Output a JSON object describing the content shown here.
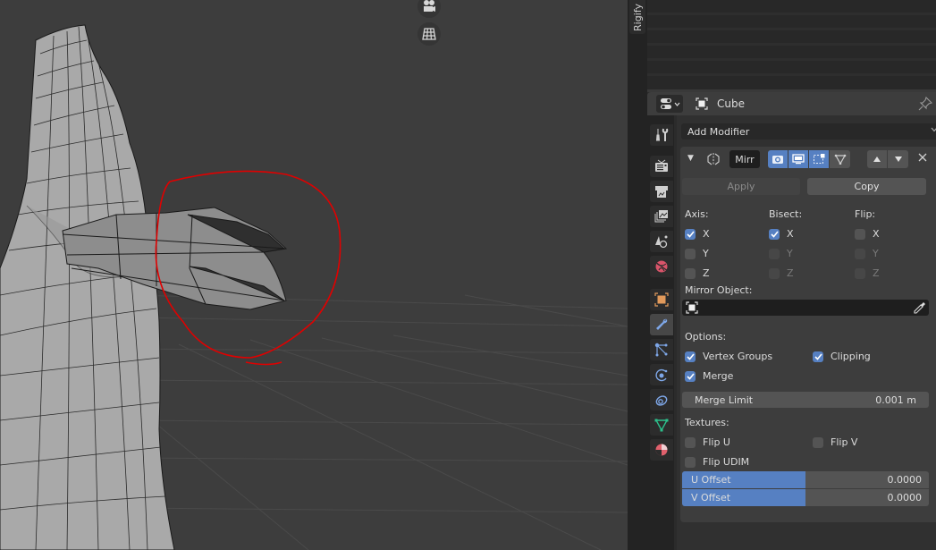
{
  "viewport": {
    "gizmos": [
      {
        "name": "camera-view-icon"
      },
      {
        "name": "perspective-grid-icon"
      }
    ],
    "annotation_color": "#e00000",
    "background": "#3d3d3d"
  },
  "sidebar": {
    "tab_label": "Rigify"
  },
  "properties": {
    "header": {
      "editor_type_icon": "properties-editor-icon",
      "object_icon": "object-icon",
      "object_name": "Cube",
      "pin_icon": "pin-icon"
    },
    "tabs": [
      {
        "name": "tool",
        "icon": "tool-icon",
        "color": "#cfcfcf",
        "active": false
      },
      {
        "name": "render",
        "icon": "render-icon",
        "color": "#cfcfcf",
        "active": false
      },
      {
        "name": "output",
        "icon": "output-icon",
        "color": "#cfcfcf",
        "active": false
      },
      {
        "name": "view-layer",
        "icon": "view-layer-icon",
        "color": "#cfcfcf",
        "active": false
      },
      {
        "name": "scene",
        "icon": "scene-icon",
        "color": "#cfcfcf",
        "active": false
      },
      {
        "name": "world",
        "icon": "world-icon",
        "color": "#d9546a",
        "active": false
      },
      {
        "name": "object",
        "icon": "object-icon",
        "color": "#e29a5b",
        "active": false
      },
      {
        "name": "modifiers",
        "icon": "wrench-icon",
        "color": "#7ea7e8",
        "active": true
      },
      {
        "name": "particles",
        "icon": "particles-icon",
        "color": "#7ea7e8",
        "active": false
      },
      {
        "name": "physics",
        "icon": "physics-icon",
        "color": "#7ea7e8",
        "active": false
      },
      {
        "name": "constraints",
        "icon": "constraints-icon",
        "color": "#7ea7e8",
        "active": false
      },
      {
        "name": "data",
        "icon": "mesh-data-icon",
        "color": "#2cc08c",
        "active": false
      },
      {
        "name": "material",
        "icon": "material-icon",
        "color": "#e0606c",
        "active": false
      }
    ],
    "add_modifier_label": "Add Modifier",
    "modifier": {
      "name": "Mirr",
      "type_icon": "mirror-modifier-icon",
      "toggles": {
        "editmode_cage": true,
        "viewport": true,
        "render": true,
        "on_cage": false
      },
      "apply_label": "Apply",
      "copy_label": "Copy",
      "axis": {
        "label": "Axis:",
        "items": [
          {
            "label": "X",
            "checked": true
          },
          {
            "label": "Y",
            "checked": false
          },
          {
            "label": "Z",
            "checked": false
          }
        ]
      },
      "bisect": {
        "label": "Bisect:",
        "items": [
          {
            "label": "X",
            "checked": true
          },
          {
            "label": "Y",
            "checked": false
          },
          {
            "label": "Z",
            "checked": false
          }
        ]
      },
      "flip": {
        "label": "Flip:",
        "items": [
          {
            "label": "X",
            "checked": false
          },
          {
            "label": "Y",
            "checked": false
          },
          {
            "label": "Z",
            "checked": false
          }
        ]
      },
      "mirror_object_label": "Mirror Object:",
      "mirror_object_value": "",
      "options_label": "Options:",
      "vertex_groups": {
        "label": "Vertex Groups",
        "checked": true
      },
      "clipping": {
        "label": "Clipping",
        "checked": true
      },
      "merge": {
        "label": "Merge",
        "checked": true
      },
      "merge_limit": {
        "label": "Merge Limit",
        "value": "0.001 m"
      },
      "textures_label": "Textures:",
      "flip_u": {
        "label": "Flip U",
        "checked": false
      },
      "flip_v": {
        "label": "Flip V",
        "checked": false
      },
      "flip_udim": {
        "label": "Flip UDIM",
        "checked": false
      },
      "u_offset": {
        "label": "U Offset",
        "value": "0.0000",
        "fill_fraction": 0.5
      },
      "v_offset": {
        "label": "V Offset",
        "value": "0.0000",
        "fill_fraction": 0.5
      }
    },
    "accent_color": "#5680c2"
  }
}
